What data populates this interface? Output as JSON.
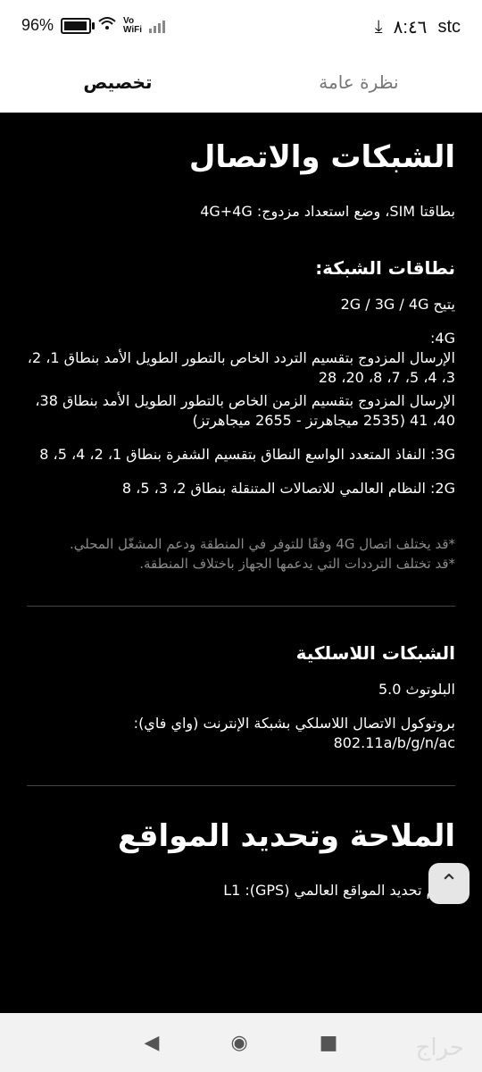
{
  "status": {
    "battery": "96%",
    "battery_level": 0.96,
    "vowifi": "Vo\nWiFi",
    "time": "٨:٤٦",
    "carrier": "stc"
  },
  "tabs": [
    {
      "label": "نظرة عامة"
    },
    {
      "label": "تخصيص"
    }
  ],
  "content": {
    "section1_title": "الشبكات والاتصال",
    "sim_text": "بطاقتا SIM، وضع استعداد مزدوج: 4G+4G",
    "bands_title": "نطاقات الشبكة:",
    "supports": "يتيح 2G / 3G / 4G",
    "lte_label": "4G:",
    "fdd_text": "الإرسال المزدوج بتقسيم التردد الخاص بالتطور الطويل الأمد بنطاق 1، 2، 3، 4، 5، 7، 8، 20، 28",
    "tdd_text": "الإرسال المزدوج بتقسيم الزمن الخاص بالتطور الطويل الأمد بنطاق 38، 40، 41 (2535 ميجاهرتز - 2655 ميجاهرتز)",
    "wcdma_text": "3G: النفاذ المتعدد الواسع النطاق بتقسيم الشفرة بنطاق 1، 2، 4، 5، 8",
    "gsm_text": "2G: النظام العالمي للاتصالات المتنقلة بنطاق 2، 3، 5، 8",
    "note1": "*قد يختلف اتصال 4G وفقًا للتوفر في المنطقة ودعم المشغّل المحلي.",
    "note2": "*قد تختلف الترددات التي يدعمها الجهاز باختلاف المنطقة.",
    "wireless_title": "الشبكات اللاسلكية",
    "bluetooth": "البلوتوث 5.0",
    "wifi_text": "بروتوكول الاتصال اللاسلكي بشبكة الإنترنت (واي فاي): 802.11a/b/g/n/ac",
    "nav_title": "الملاحة وتحديد المواقع",
    "gps_text": "نظام تحديد المواقع العالمي (GPS): L1"
  },
  "fab": {
    "icon": "chevron-up-icon",
    "glyph": "⌃"
  },
  "navbar": {
    "back_glyph": "◀",
    "home_glyph": "◉",
    "recent_glyph": "■"
  },
  "watermark": {
    "text": "حراج"
  }
}
